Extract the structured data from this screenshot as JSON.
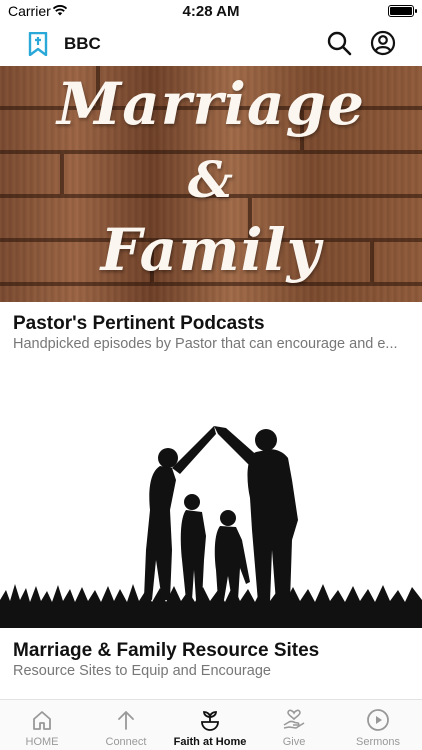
{
  "status": {
    "carrier": "Carrier",
    "time": "4:28 AM",
    "battery_level": 1.0
  },
  "header": {
    "title": "BBC",
    "logo_icon": "bookmark-cross-icon",
    "search_icon": "search-icon",
    "account_icon": "account-icon",
    "accent": "#2aa8d8"
  },
  "cards": [
    {
      "hero_lines": [
        "Marriage",
        "&",
        "Family"
      ],
      "title": "Pastor's Pertinent Podcasts",
      "subtitle": "Handpicked episodes by Pastor that can encourage and e..."
    },
    {
      "image": "family-silhouette-illustration",
      "title": "Marriage & Family Resource Sites",
      "subtitle": "Resource Sites to Equip and Encourage"
    }
  ],
  "tabs": [
    {
      "label": "HOME",
      "icon": "home-icon",
      "active": false
    },
    {
      "label": "Connect",
      "icon": "arrow-up-icon",
      "active": false
    },
    {
      "label": "Faith at Home",
      "icon": "sprout-bowl-icon",
      "active": true
    },
    {
      "label": "Give",
      "icon": "hand-heart-icon",
      "active": false
    },
    {
      "label": "Sermons",
      "icon": "play-circle-icon",
      "active": false
    }
  ]
}
